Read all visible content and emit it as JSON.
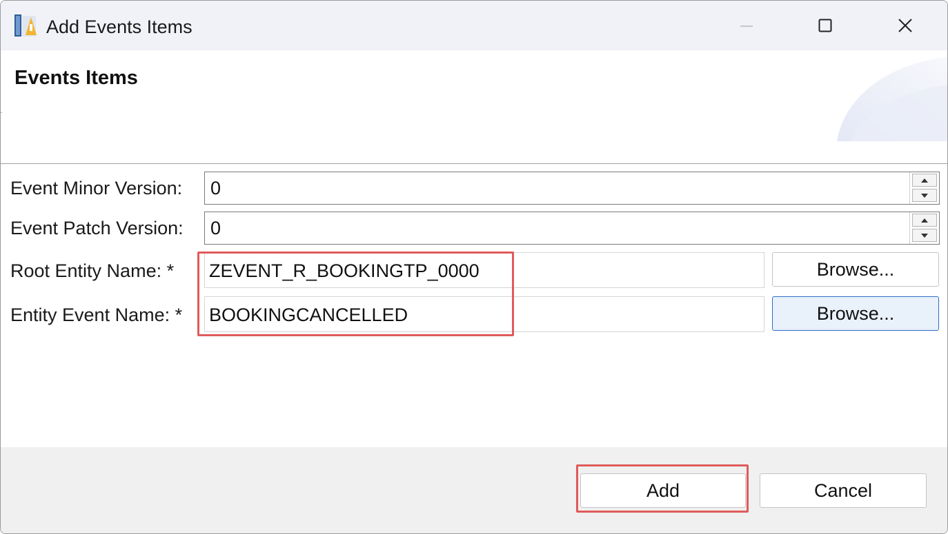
{
  "window": {
    "title": "Add Events Items"
  },
  "header": {
    "title": "Events Items"
  },
  "form": {
    "minor_version": {
      "label": "Event Minor Version:",
      "value": "0"
    },
    "patch_version": {
      "label": "Event Patch Version:",
      "value": "0"
    },
    "root_entity": {
      "label": "Root Entity Name: *",
      "value": "ZEVENT_R_BOOKINGTP_0000",
      "browse_label": "Browse..."
    },
    "entity_event": {
      "label": "Entity Event Name: *",
      "value": "BOOKINGCANCELLED",
      "browse_label": "Browse..."
    }
  },
  "footer": {
    "add_label": "Add",
    "cancel_label": "Cancel"
  },
  "colors": {
    "highlight": "#e05a5a",
    "focus_border": "#2b6cc4",
    "titlebar_bg": "#f0f2f7",
    "footer_bg": "#f0f0f0"
  },
  "icons": {
    "app": "app-icon",
    "minimize": "minimize-icon",
    "maximize": "maximize-icon",
    "close": "close-icon",
    "spin_up": "arrow-up-icon",
    "spin_down": "arrow-down-icon"
  }
}
